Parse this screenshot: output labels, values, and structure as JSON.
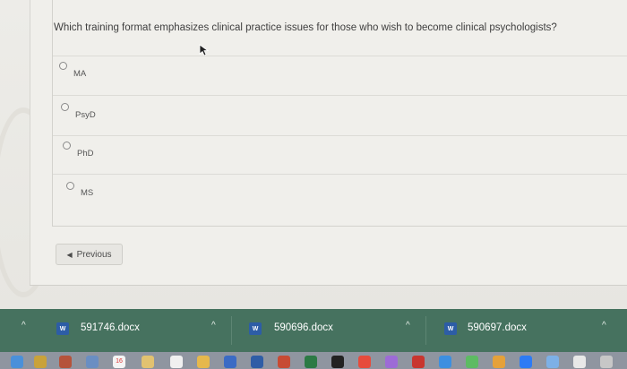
{
  "quiz": {
    "question": "Which training format emphasizes clinical practice issues for those who wish to become clinical psychologists?",
    "options": [
      "MA",
      "PsyD",
      "PhD",
      "MS"
    ],
    "previous_label": "Previous"
  },
  "downloads": {
    "items": [
      {
        "name": "591746.docx",
        "icon": "word-doc-icon"
      },
      {
        "name": "590696.docx",
        "icon": "word-doc-icon"
      },
      {
        "name": "590697.docx",
        "icon": "word-doc-icon"
      }
    ],
    "chevron": "^"
  },
  "dock": {
    "calendar_day": "16"
  },
  "colors": {
    "downloads_bar": "#46725f",
    "doc_icon": "#2d5da6"
  }
}
